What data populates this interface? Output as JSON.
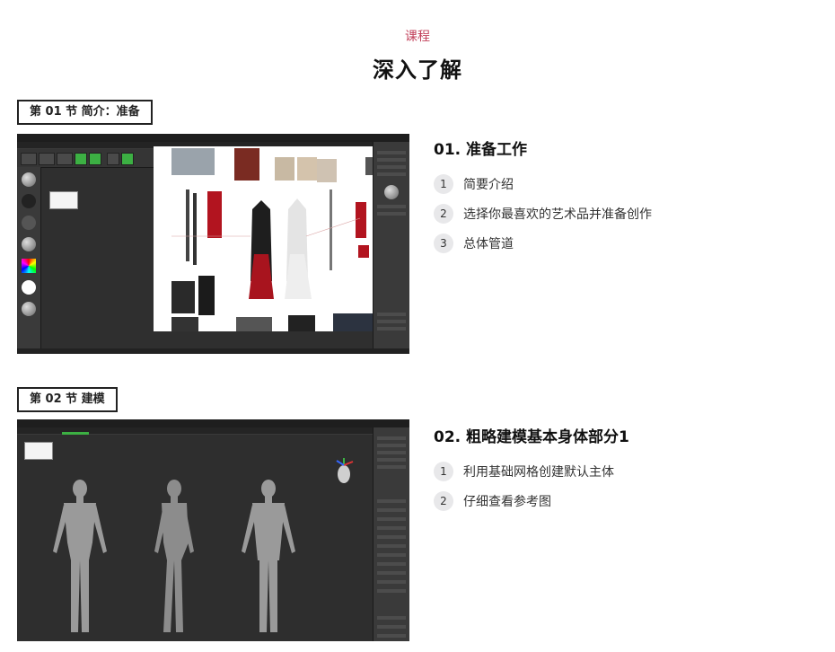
{
  "header": {
    "eyebrow": "课程",
    "title": "深入了解"
  },
  "sections": [
    {
      "tag": "第 01 节 简介：准备",
      "lesson_title": "01. 准备工作",
      "items": [
        {
          "num": "1",
          "text": "简要介绍"
        },
        {
          "num": "2",
          "text": "选择你最喜欢的艺术品并准备创作"
        },
        {
          "num": "3",
          "text": "总体管道"
        }
      ]
    },
    {
      "tag": "第 02 节 建模",
      "lesson_title": "02. 粗略建模基本身体部分1",
      "items": [
        {
          "num": "1",
          "text": "利用基础网格创建默认主体"
        },
        {
          "num": "2",
          "text": "仔细查看参考图"
        }
      ]
    }
  ],
  "colors": {
    "eyebrow": "#c2415b",
    "app_background": "#2b2b2b",
    "accent_green": "#3cb043"
  }
}
